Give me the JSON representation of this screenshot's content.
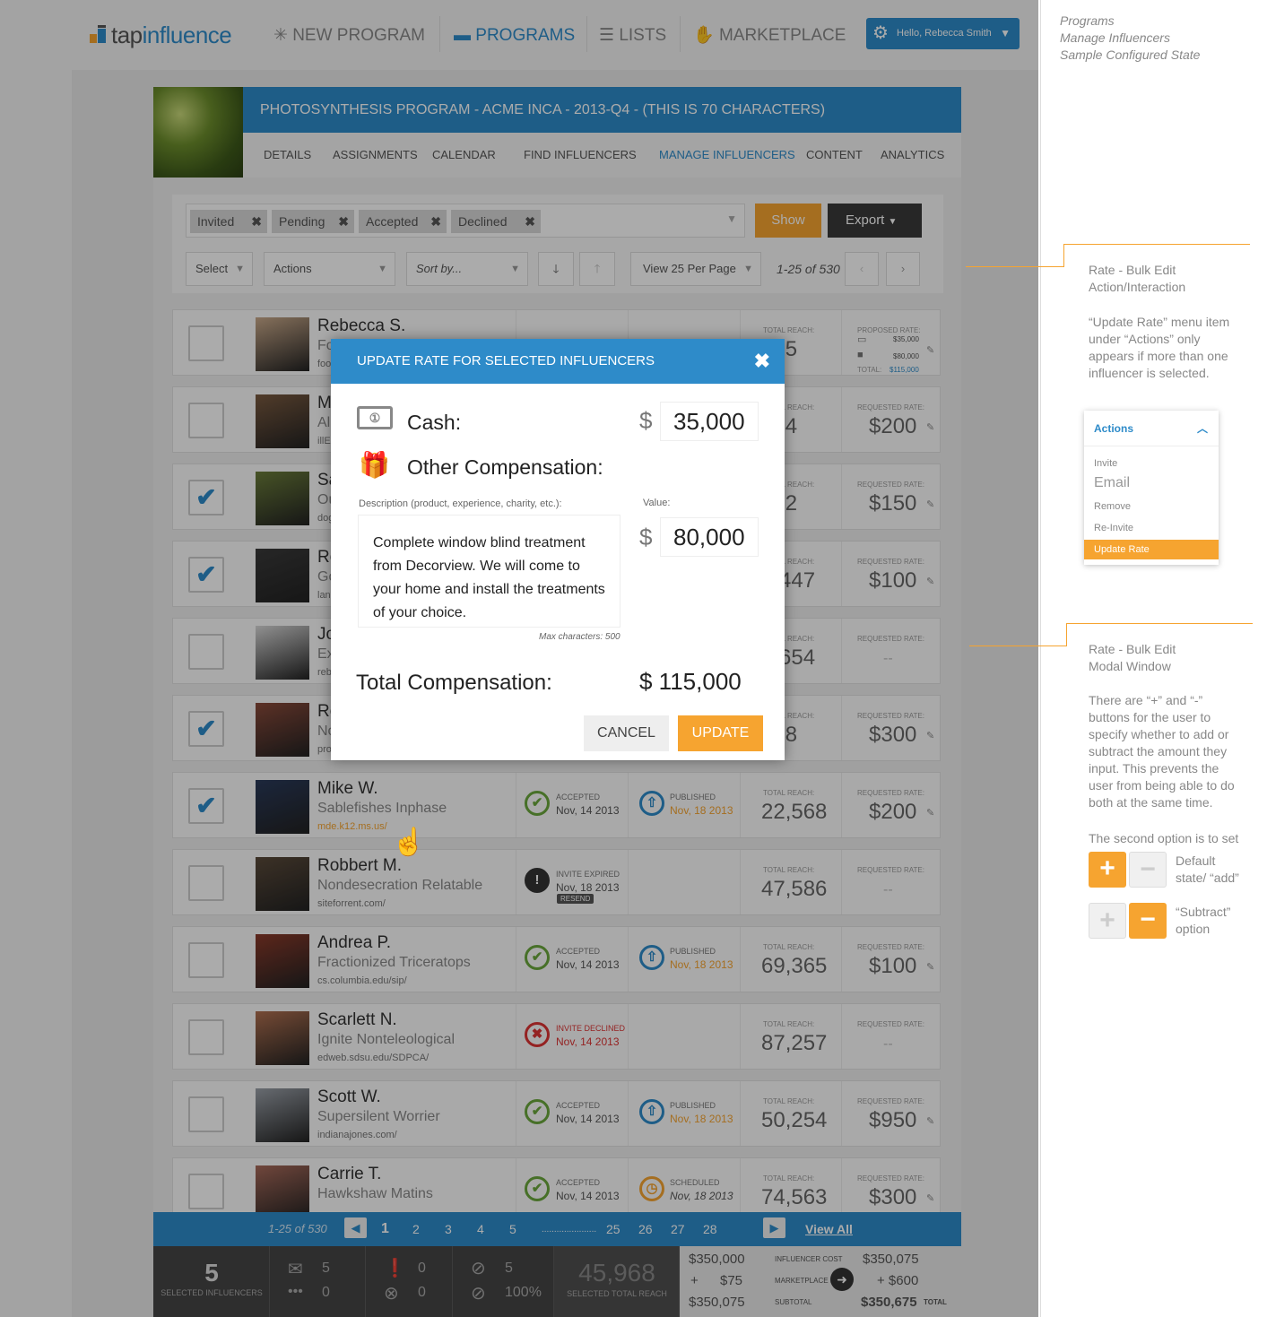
{
  "brand": {
    "tap": "tap",
    "influence": "influence"
  },
  "nav": {
    "new_program": "NEW PROGRAM",
    "programs": "PROGRAMS",
    "lists": "LISTS",
    "marketplace": "MARKETPLACE",
    "user": "Hello, Rebecca Smith"
  },
  "program": {
    "title": "PHOTOSYNTHESIS PROGRAM - ACME INCA - 2013-Q4 - (THIS IS 70 CHARACTERS)"
  },
  "tabs": [
    "DETAILS",
    "ASSIGNMENTS",
    "CALENDAR",
    "FIND INFLUENCERS",
    "MANAGE INFLUENCERS",
    "CONTENT",
    "ANALYTICS"
  ],
  "filters": {
    "chips": [
      "Invited",
      "Pending",
      "Accepted",
      "Declined"
    ],
    "show": "Show",
    "export": "Export",
    "select": "Select",
    "actions": "Actions",
    "sort": "Sort by...",
    "per_page": "View 25 Per Page",
    "range": "1-25 of 530"
  },
  "rows": [
    {
      "name": "Rebecca S.",
      "company": "Fo",
      "url": "foo",
      "checked": false,
      "reach": "415",
      "rate_label": "PROPOSED RATE:",
      "rate": ""
    },
    {
      "name": "M",
      "company": "All",
      "url": "illE",
      "checked": false,
      "reach": "354",
      "rate_label": "REQUESTED RATE:",
      "rate": "$200"
    },
    {
      "name": "Sa",
      "company": "Ou",
      "url": "dog",
      "checked": true,
      "reach": "542",
      "rate_label": "REQUESTED RATE:",
      "rate": "$150"
    },
    {
      "name": "Ro",
      "company": "Go",
      "url": "lan",
      "checked": true,
      "reach": "5,447",
      "rate_label": "REQUESTED RATE:",
      "rate": "$100"
    },
    {
      "name": "Jo",
      "company": "Ex",
      "url": "reb",
      "checked": false,
      "reach": "3,654",
      "rate_label": "REQUESTED RATE:",
      "rate": "--"
    },
    {
      "name": "Ro",
      "company": "No",
      "url": "pro",
      "checked": true,
      "reach": "958",
      "rate_label": "REQUESTED RATE:",
      "rate": "$300"
    },
    {
      "name": "Mike W.",
      "company": "Sablefishes Inphase",
      "url": "mde.k12.ms.us/",
      "checked": true,
      "status": "ACCEPTED",
      "status_date": "Nov, 14 2013",
      "status2": "PUBLISHED",
      "status2_date": "Nov, 18 2013",
      "reach": "22,568",
      "rate_label": "REQUESTED RATE:",
      "rate": "$200"
    },
    {
      "name": "Robbert M.",
      "company": "Nondesecration Relatable",
      "url": "siteforrent.com/",
      "checked": false,
      "status": "INVITE EXPIRED",
      "status_date": "Nov, 18 2013",
      "resend": "RESEND",
      "reach": "47,586",
      "rate_label": "REQUESTED RATE:",
      "rate": "--"
    },
    {
      "name": "Andrea P.",
      "company": "Fractionized Triceratops",
      "url": "cs.columbia.edu/sip/",
      "checked": false,
      "status": "ACCEPTED",
      "status_date": "Nov, 14 2013",
      "status2": "PUBLISHED",
      "status2_date": "Nov, 18 2013",
      "reach": "69,365",
      "rate_label": "REQUESTED RATE:",
      "rate": "$100"
    },
    {
      "name": "Scarlett N.",
      "company": "Ignite Nonteleological",
      "url": "edweb.sdsu.edu/SDPCA/",
      "checked": false,
      "status": "INVITE DECLINED",
      "status_date": "Nov, 14 2013",
      "reach": "87,257",
      "rate_label": "REQUESTED RATE:",
      "rate": "--"
    },
    {
      "name": "Scott W.",
      "company": "Supersilent Worrier",
      "url": "indianajones.com/",
      "checked": false,
      "status": "ACCEPTED",
      "status_date": "Nov, 14 2013",
      "status2": "PUBLISHED",
      "status2_date": "Nov, 18 2013",
      "reach": "50,254",
      "rate_label": "REQUESTED RATE:",
      "rate": "$950"
    },
    {
      "name": "Carrie T.",
      "company": "Hawkshaw Matins",
      "url": "",
      "checked": false,
      "status": "ACCEPTED",
      "status_date": "Nov, 14 2013",
      "status2": "SCHEDULED",
      "status2_date": "Nov, 18 2013",
      "reach": "74,563",
      "rate_label": "REQUESTED RATE:",
      "rate": "$300"
    }
  ],
  "reach_label": "TOTAL REACH:",
  "proposed": {
    "cash": "$35,000",
    "other": "$80,000",
    "total_label": "TOTAL:",
    "total": "$115,000"
  },
  "pager": {
    "range": "1-25 of 530",
    "pages": [
      "1",
      "2",
      "3",
      "4",
      "5",
      "25",
      "26",
      "27",
      "28"
    ],
    "ellipsis": "......................",
    "view_all": "View All"
  },
  "summary": {
    "selected": "5",
    "selected_label": "SELECTED INFLUENCERS",
    "mail": "5",
    "mail2": "0",
    "alert": "0",
    "alert2": "0",
    "check": "5",
    "check2": "100%",
    "reach": "45,968",
    "reach_label": "SELECTED TOTAL REACH",
    "cost": "$350,000",
    "cost_label": "INFLUENCER COST",
    "fee_sign": "+",
    "fee": "$75",
    "fee_label": "MARKETPLACE FEE",
    "subtotal": "$350,075",
    "subtotal_label": "SUBTOTAL",
    "right_cash": "$350,075",
    "right_other": "+ $600",
    "total": "$350,675",
    "total_label": "TOTAL"
  },
  "modal": {
    "title": "UPDATE RATE FOR SELECTED INFLUENCERS",
    "cash_label": "Cash:",
    "currency": "$",
    "cash_value": "35,000",
    "other_label": "Other Compensation:",
    "desc_label": "Description (product, experience, charity, etc.):",
    "value_label": "Value:",
    "desc_text": "Complete window blind treatment from Decorview.  We will come to your home and install the treatments of your choice.",
    "other_value": "80,000",
    "max_chars": "Max characters: 500",
    "total_label": "Total Compensation:",
    "total_value": "$ 115,000",
    "cancel": "CANCEL",
    "update": "UPDATE"
  },
  "notes": {
    "header": [
      "Programs",
      "Manage Influencers",
      "Sample Configured State"
    ],
    "action_title": [
      "Rate - Bulk Edit",
      "Action/Interaction"
    ],
    "action_body": [
      "“Update Rate” menu item",
      "under “Actions” only",
      "appears if more than one",
      "influencer is selected."
    ],
    "dropdown": {
      "head": "Actions",
      "items": [
        "Invite",
        "Email",
        "Remove",
        "Re-Invite",
        "Update Rate"
      ]
    },
    "modal_title": [
      "Rate - Bulk Edit",
      "Modal Window"
    ],
    "modal_body": [
      "There are “+” and “-”",
      "buttons for the user to",
      "specify whether to add or",
      "subtract the amount they",
      "input. This prevents the",
      "user from being able to do",
      "both at the same time."
    ],
    "second": "The second option is to set",
    "default_label": [
      "Default",
      "state/ “add”"
    ],
    "subtract_label": [
      "“Subtract”",
      "option"
    ]
  },
  "colors": {
    "brand_blue": "#2e8bc9",
    "accent_orange": "#f6a430",
    "dark": "#3a3a3a"
  }
}
